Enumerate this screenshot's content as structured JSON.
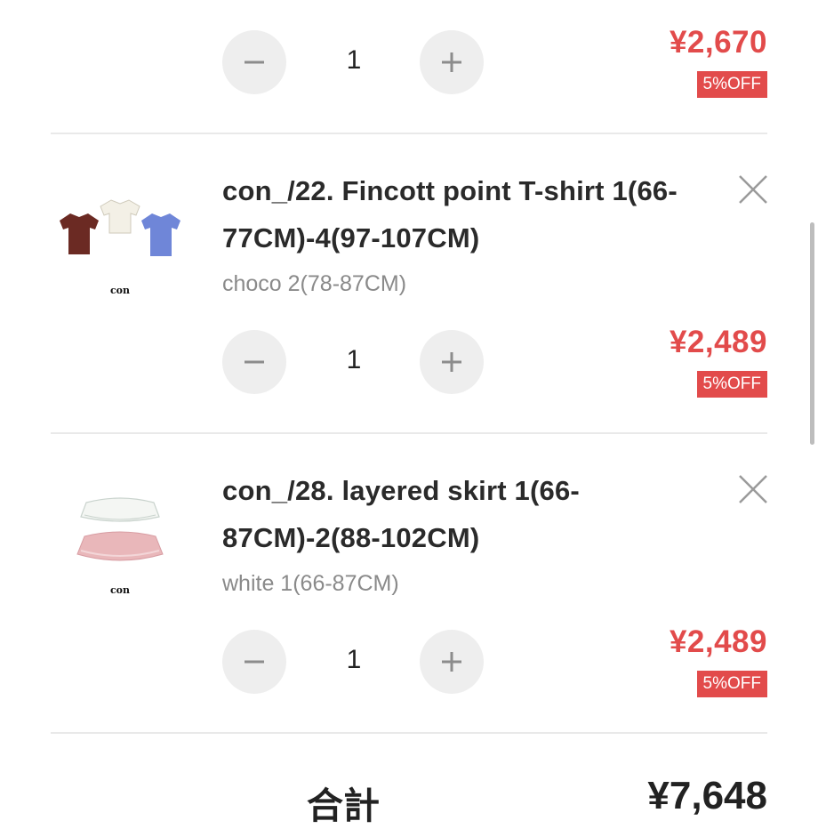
{
  "cart": {
    "items": [
      {
        "title": "",
        "variant": "",
        "quantity": "1",
        "price": "¥2,670",
        "discount": "5%OFF"
      },
      {
        "title": "con_/22. Fincott point T-shirt 1(66-77CM)-4(97-107CM)",
        "title_line1": "con_/22. Fincott point T-shirt 1(66-",
        "title_line2": "77CM)-4(97-107CM)",
        "variant": "choco 2(78-87CM)",
        "quantity": "1",
        "price": "¥2,489",
        "discount": "5%OFF",
        "thumb_brand": "con"
      },
      {
        "title": "con_/28. layered skirt 1(66-87CM)-2(88-102CM)",
        "title_line1": "con_/28. layered skirt 1(66-",
        "title_line2": "87CM)-2(88-102CM)",
        "variant": "white 1(66-87CM)",
        "quantity": "1",
        "price": "¥2,489",
        "discount": "5%OFF",
        "thumb_brand": "con"
      }
    ],
    "total_label": "合計",
    "total_value": "¥7,648"
  },
  "icons": {
    "minus": "minus-icon",
    "plus": "plus-icon",
    "remove": "close-icon"
  },
  "colors": {
    "price_red": "#e24b4b",
    "button_gray": "#eeeeee",
    "divider": "#e9e9e9"
  }
}
